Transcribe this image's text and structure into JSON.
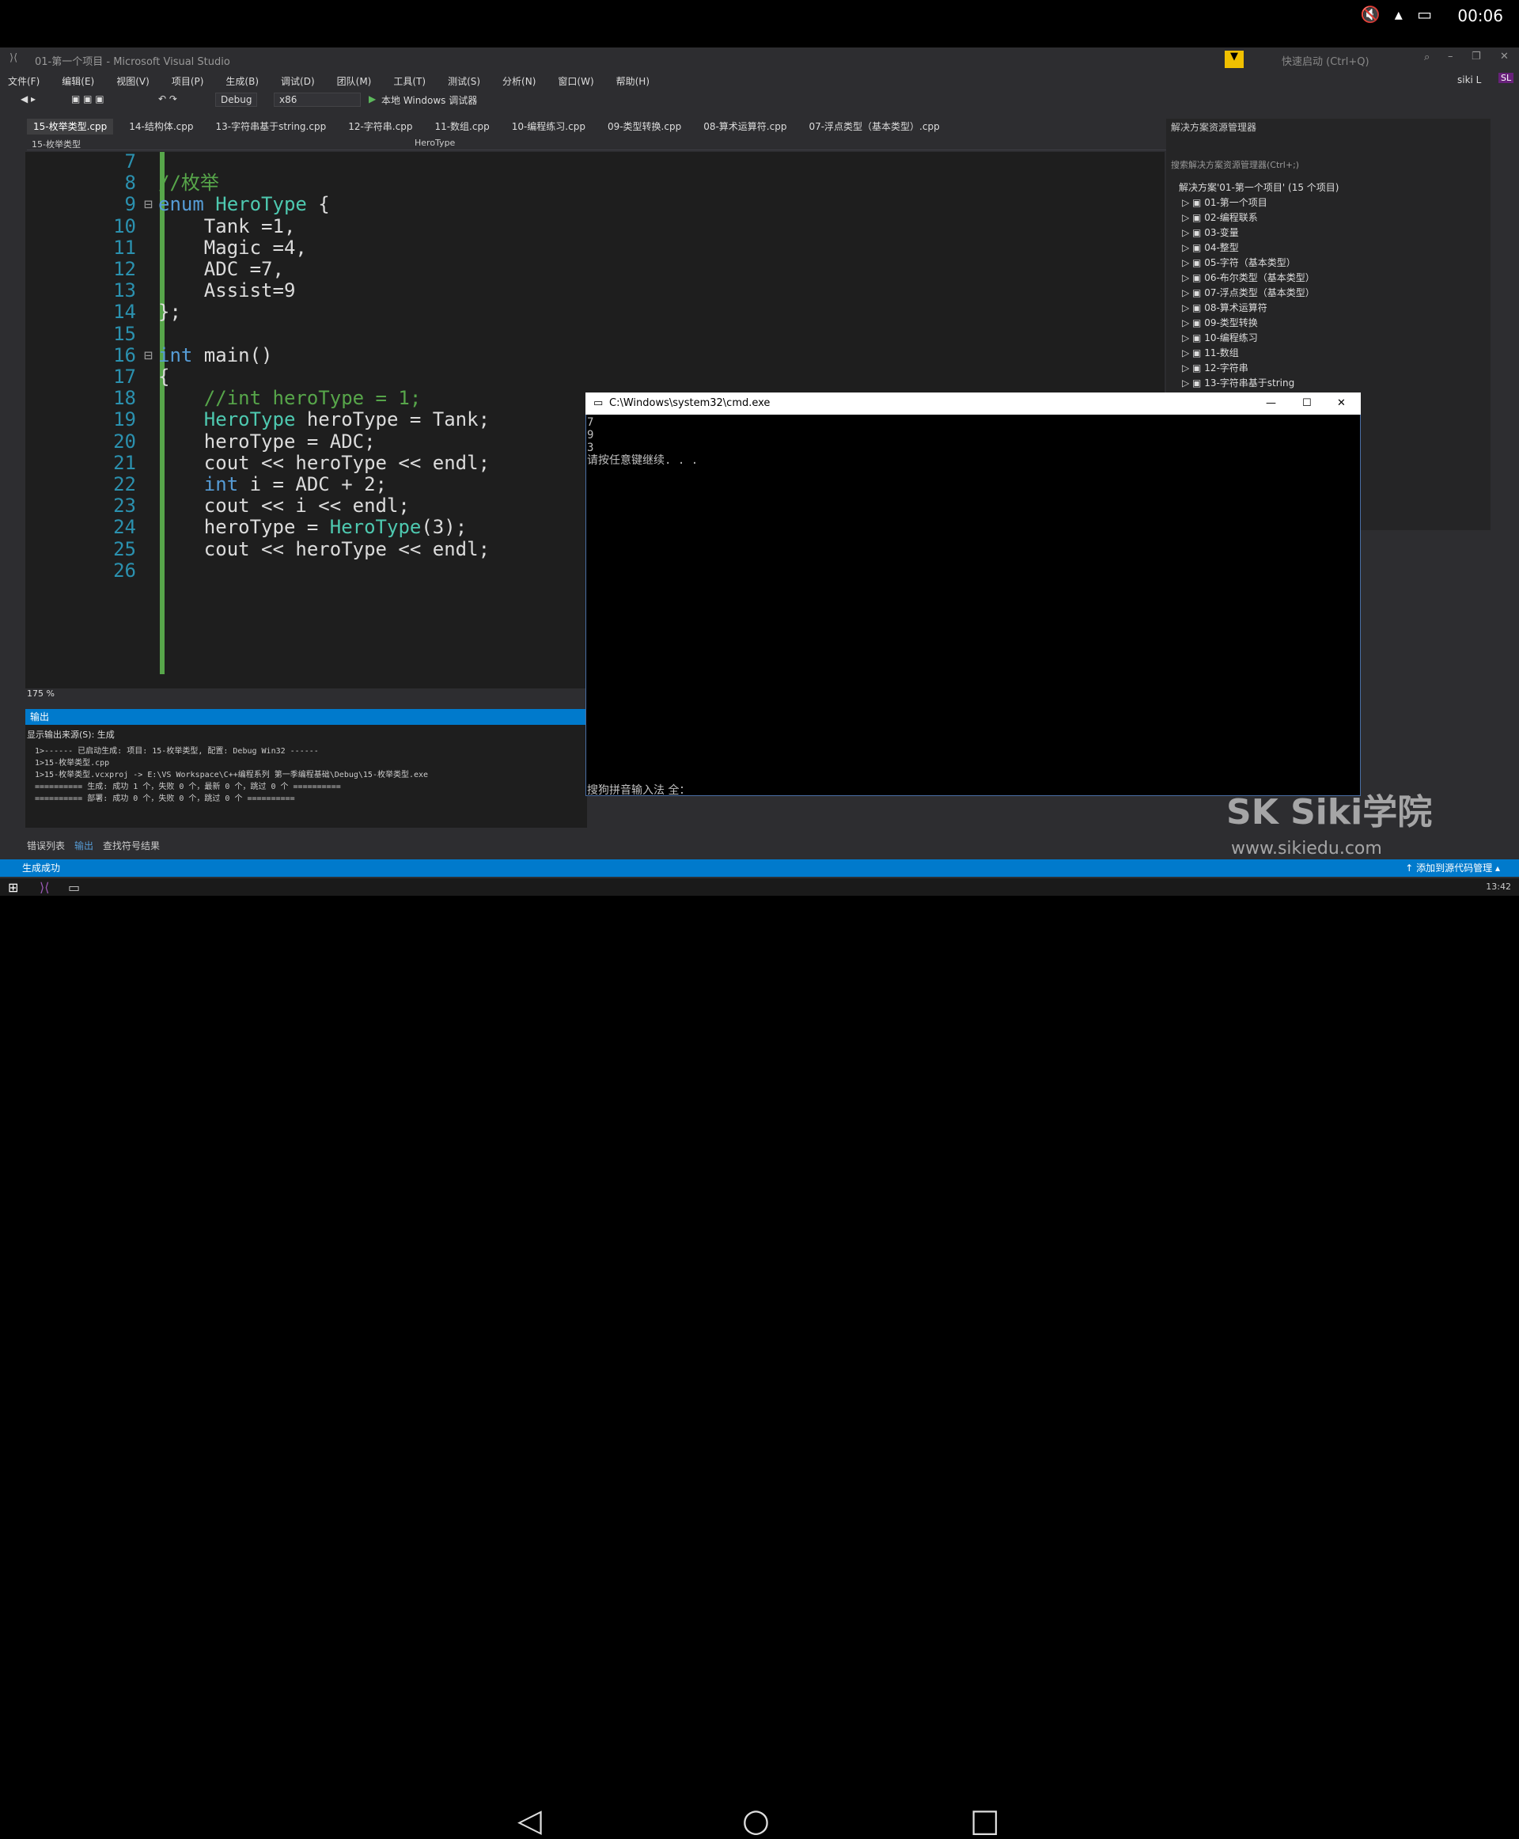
{
  "device": {
    "time": "00:06",
    "status_icons": "🔇 ▴ ▭"
  },
  "vs": {
    "window_title": "01-第一个项目 - Microsoft Visual Studio",
    "quick_launch": "快速启动 (Ctrl+Q)",
    "user": "siki L",
    "menus": [
      "文件(F)",
      "编辑(E)",
      "视图(V)",
      "项目(P)",
      "生成(B)",
      "调试(D)",
      "团队(M)",
      "工具(T)",
      "测试(S)",
      "分析(N)",
      "窗口(W)",
      "帮助(H)"
    ],
    "config": "Debug",
    "platform": "x86",
    "run_label": "本地 Windows 调试器",
    "tabs": [
      "15-枚举类型.cpp",
      "14-结构体.cpp",
      "13-字符串基于string.cpp",
      "12-字符串.cpp",
      "11-数组.cpp",
      "10-编程练习.cpp",
      "09-类型转换.cpp",
      "08-算术运算符.cpp",
      "07-浮点类型（基本类型）.cpp"
    ],
    "nav_file": "15-枚举类型",
    "nav_scope": "HeroType",
    "zoom": "175 %",
    "code": [
      {
        "n": "7",
        "t": ""
      },
      {
        "n": "8",
        "t": "//枚举"
      },
      {
        "n": "9",
        "t": "enum HeroType {"
      },
      {
        "n": "10",
        "t": "    Tank =1,"
      },
      {
        "n": "11",
        "t": "    Magic =4,"
      },
      {
        "n": "12",
        "t": "    ADC =7,"
      },
      {
        "n": "13",
        "t": "    Assist=9"
      },
      {
        "n": "14",
        "t": "};"
      },
      {
        "n": "15",
        "t": ""
      },
      {
        "n": "16",
        "t": "int main()"
      },
      {
        "n": "17",
        "t": "{"
      },
      {
        "n": "18",
        "t": "    //int heroType = 1;"
      },
      {
        "n": "19",
        "t": "    HeroType heroType = Tank;"
      },
      {
        "n": "20",
        "t": "    heroType = ADC;"
      },
      {
        "n": "21",
        "t": "    cout << heroType << endl;"
      },
      {
        "n": "22",
        "t": "    int i = ADC + 2;"
      },
      {
        "n": "23",
        "t": "    cout << i << endl;"
      },
      {
        "n": "24",
        "t": "    heroType = HeroType(3);"
      },
      {
        "n": "25",
        "t": "    cout << heroType << endl;"
      },
      {
        "n": "26",
        "t": ""
      }
    ],
    "output": {
      "title": "输出",
      "source_label": "显示输出来源(S): 生成",
      "lines": [
        "1>------ 已启动生成: 项目: 15-枚举类型, 配置: Debug Win32 ------",
        "1>15-枚举类型.cpp",
        "1>15-枚举类型.vcxproj -> E:\\VS Workspace\\C++编程系列 第一季编程基础\\Debug\\15-枚举类型.exe",
        "========== 生成: 成功 1 个，失败 0 个，最新 0 个，跳过 0 个 ==========",
        "========== 部署: 成功 0 个，失败 0 个，跳过 0 个 =========="
      ]
    },
    "bottom_tabs": [
      "错误列表",
      "输出",
      "查找符号结果"
    ],
    "status": "生成成功",
    "status_right": "↑ 添加到源代码管理 ▴",
    "taskbar_time": "13:42",
    "solution_explorer": {
      "title": "解决方案资源管理器",
      "search": "搜索解决方案资源管理器(Ctrl+;)",
      "root": "解决方案'01-第一个项目' (15 个项目)",
      "items": [
        "01-第一个项目",
        "02-编程联系",
        "03-变量",
        "04-整型",
        "05-字符（基本类型）",
        "06-布尔类型（基本类型）",
        "07-浮点类型（基本类型）",
        "08-算术运算符",
        "09-类型转换",
        "10-编程练习",
        "11-数组",
        "12-字符串",
        "13-字符串基于string"
      ]
    }
  },
  "cmd": {
    "title": "C:\\Windows\\system32\\cmd.exe",
    "output": "7\n9\n3\n请按任意键继续. . .",
    "ime": "搜狗拼音输入法 全："
  },
  "watermark": {
    "brand": "SK Siki学院",
    "url": "www.sikiedu.com"
  }
}
